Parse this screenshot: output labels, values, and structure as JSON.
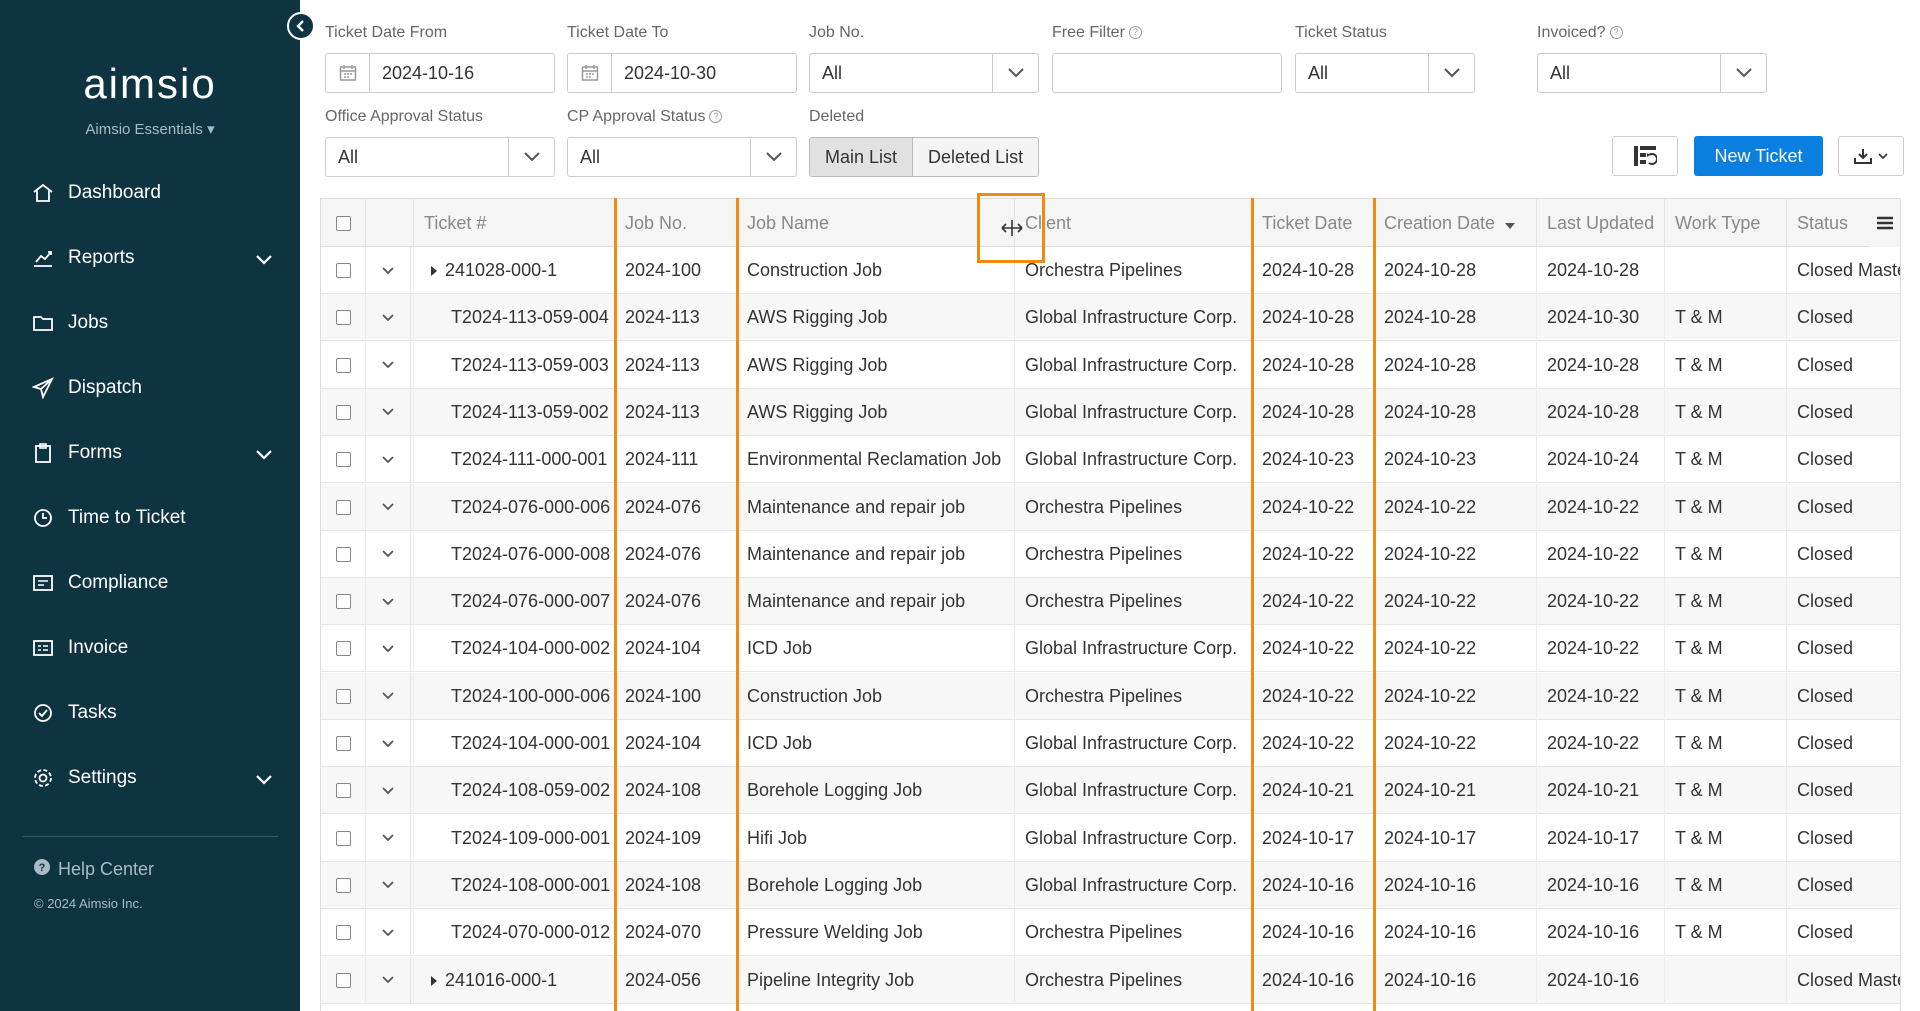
{
  "app": {
    "logo_text": "aimsio",
    "org_name": "Aimsio Essentials",
    "org_chevron": "▾"
  },
  "sidebar": {
    "items": [
      {
        "label": "Dashboard",
        "icon": "home-icon",
        "has_chevron": false
      },
      {
        "label": "Reports",
        "icon": "chart-icon",
        "has_chevron": true
      },
      {
        "label": "Jobs",
        "icon": "folder-icon",
        "has_chevron": false
      },
      {
        "label": "Dispatch",
        "icon": "send-icon",
        "has_chevron": false
      },
      {
        "label": "Forms",
        "icon": "clipboard-icon",
        "has_chevron": true
      },
      {
        "label": "Time to Ticket",
        "icon": "clock-icon",
        "has_chevron": false
      },
      {
        "label": "Compliance",
        "icon": "compliance-icon",
        "has_chevron": false
      },
      {
        "label": "Invoice",
        "icon": "invoice-icon",
        "has_chevron": false
      },
      {
        "label": "Tasks",
        "icon": "check-circle-icon",
        "has_chevron": false
      },
      {
        "label": "Settings",
        "icon": "gear-icon",
        "has_chevron": true
      }
    ],
    "help_label": "Help Center",
    "copyright": "© 2024 Aimsio Inc."
  },
  "filters": {
    "date_from": {
      "label": "Ticket Date From",
      "value": "2024-10-16"
    },
    "date_to": {
      "label": "Ticket Date To",
      "value": "2024-10-30"
    },
    "job_no": {
      "label": "Job No.",
      "value": "All"
    },
    "free_filter": {
      "label": "Free Filter",
      "value": "",
      "placeholder": ""
    },
    "ticket_status": {
      "label": "Ticket Status",
      "value": "All"
    },
    "invoiced": {
      "label": "Invoiced?",
      "value": "All"
    },
    "office_approval": {
      "label": "Office Approval Status",
      "value": "All"
    },
    "cp_approval": {
      "label": "CP Approval Status",
      "value": "All"
    },
    "deleted": {
      "label": "Deleted",
      "main_list": "Main List",
      "deleted_list": "Deleted List"
    }
  },
  "toolbar": {
    "new_ticket_label": "New Ticket",
    "accent": "#0a7fe0"
  },
  "grid": {
    "columns": [
      "Ticket #",
      "Job No.",
      "Job Name",
      "Client",
      "Ticket Date",
      "Creation Date",
      "Last Updated",
      "Work Type",
      "Status"
    ],
    "sort_column": "Creation Date",
    "sort_dir": "desc",
    "rows": [
      {
        "ticket": "241028-000-1",
        "group": true,
        "job_no": "2024-100",
        "job_name": "Construction Job",
        "client": "Orchestra Pipelines",
        "ticket_date": "2024-10-28",
        "created": "2024-10-28",
        "updated": "2024-10-28",
        "work_type": "",
        "status": "Closed Master"
      },
      {
        "ticket": "T2024-113-059-004",
        "group": false,
        "job_no": "2024-113",
        "job_name": "AWS Rigging Job",
        "client": "Global Infrastructure Corp.",
        "ticket_date": "2024-10-28",
        "created": "2024-10-28",
        "updated": "2024-10-30",
        "work_type": "T & M",
        "status": "Closed"
      },
      {
        "ticket": "T2024-113-059-003",
        "group": false,
        "job_no": "2024-113",
        "job_name": "AWS Rigging Job",
        "client": "Global Infrastructure Corp.",
        "ticket_date": "2024-10-28",
        "created": "2024-10-28",
        "updated": "2024-10-28",
        "work_type": "T & M",
        "status": "Closed"
      },
      {
        "ticket": "T2024-113-059-002",
        "group": false,
        "job_no": "2024-113",
        "job_name": "AWS Rigging Job",
        "client": "Global Infrastructure Corp.",
        "ticket_date": "2024-10-28",
        "created": "2024-10-28",
        "updated": "2024-10-28",
        "work_type": "T & M",
        "status": "Closed"
      },
      {
        "ticket": "T2024-111-000-001",
        "group": false,
        "job_no": "2024-111",
        "job_name": "Environmental Reclamation Job",
        "client": "Global Infrastructure Corp.",
        "ticket_date": "2024-10-23",
        "created": "2024-10-23",
        "updated": "2024-10-24",
        "work_type": "T & M",
        "status": "Closed"
      },
      {
        "ticket": "T2024-076-000-006",
        "group": false,
        "job_no": "2024-076",
        "job_name": "Maintenance and repair job",
        "client": "Orchestra Pipelines",
        "ticket_date": "2024-10-22",
        "created": "2024-10-22",
        "updated": "2024-10-22",
        "work_type": "T & M",
        "status": "Closed"
      },
      {
        "ticket": "T2024-076-000-008",
        "group": false,
        "job_no": "2024-076",
        "job_name": "Maintenance and repair job",
        "client": "Orchestra Pipelines",
        "ticket_date": "2024-10-22",
        "created": "2024-10-22",
        "updated": "2024-10-22",
        "work_type": "T & M",
        "status": "Closed"
      },
      {
        "ticket": "T2024-076-000-007",
        "group": false,
        "job_no": "2024-076",
        "job_name": "Maintenance and repair job",
        "client": "Orchestra Pipelines",
        "ticket_date": "2024-10-22",
        "created": "2024-10-22",
        "updated": "2024-10-22",
        "work_type": "T & M",
        "status": "Closed"
      },
      {
        "ticket": "T2024-104-000-002",
        "group": false,
        "job_no": "2024-104",
        "job_name": "ICD Job",
        "client": "Global Infrastructure Corp.",
        "ticket_date": "2024-10-22",
        "created": "2024-10-22",
        "updated": "2024-10-22",
        "work_type": "T & M",
        "status": "Closed"
      },
      {
        "ticket": "T2024-100-000-006",
        "group": false,
        "job_no": "2024-100",
        "job_name": "Construction Job",
        "client": "Orchestra Pipelines",
        "ticket_date": "2024-10-22",
        "created": "2024-10-22",
        "updated": "2024-10-22",
        "work_type": "T & M",
        "status": "Closed"
      },
      {
        "ticket": "T2024-104-000-001",
        "group": false,
        "job_no": "2024-104",
        "job_name": "ICD Job",
        "client": "Global Infrastructure Corp.",
        "ticket_date": "2024-10-22",
        "created": "2024-10-22",
        "updated": "2024-10-22",
        "work_type": "T & M",
        "status": "Closed"
      },
      {
        "ticket": "T2024-108-059-002",
        "group": false,
        "job_no": "2024-108",
        "job_name": "Borehole Logging Job",
        "client": "Global Infrastructure Corp.",
        "ticket_date": "2024-10-21",
        "created": "2024-10-21",
        "updated": "2024-10-21",
        "work_type": "T & M",
        "status": "Closed"
      },
      {
        "ticket": "T2024-109-000-001",
        "group": false,
        "job_no": "2024-109",
        "job_name": "Hifi Job",
        "client": "Global Infrastructure Corp.",
        "ticket_date": "2024-10-17",
        "created": "2024-10-17",
        "updated": "2024-10-17",
        "work_type": "T & M",
        "status": "Closed"
      },
      {
        "ticket": "T2024-108-000-001",
        "group": false,
        "job_no": "2024-108",
        "job_name": "Borehole Logging Job",
        "client": "Global Infrastructure Corp.",
        "ticket_date": "2024-10-16",
        "created": "2024-10-16",
        "updated": "2024-10-16",
        "work_type": "T & M",
        "status": "Closed"
      },
      {
        "ticket": "T2024-070-000-012",
        "group": false,
        "job_no": "2024-070",
        "job_name": "Pressure Welding Job",
        "client": "Orchestra Pipelines",
        "ticket_date": "2024-10-16",
        "created": "2024-10-16",
        "updated": "2024-10-16",
        "work_type": "T & M",
        "status": "Closed"
      },
      {
        "ticket": "241016-000-1",
        "group": true,
        "job_no": "2024-056",
        "job_name": "Pipeline Integrity Job",
        "client": "Orchestra Pipelines",
        "ticket_date": "2024-10-16",
        "created": "2024-10-16",
        "updated": "2024-10-16",
        "work_type": "",
        "status": "Closed Master"
      }
    ]
  }
}
